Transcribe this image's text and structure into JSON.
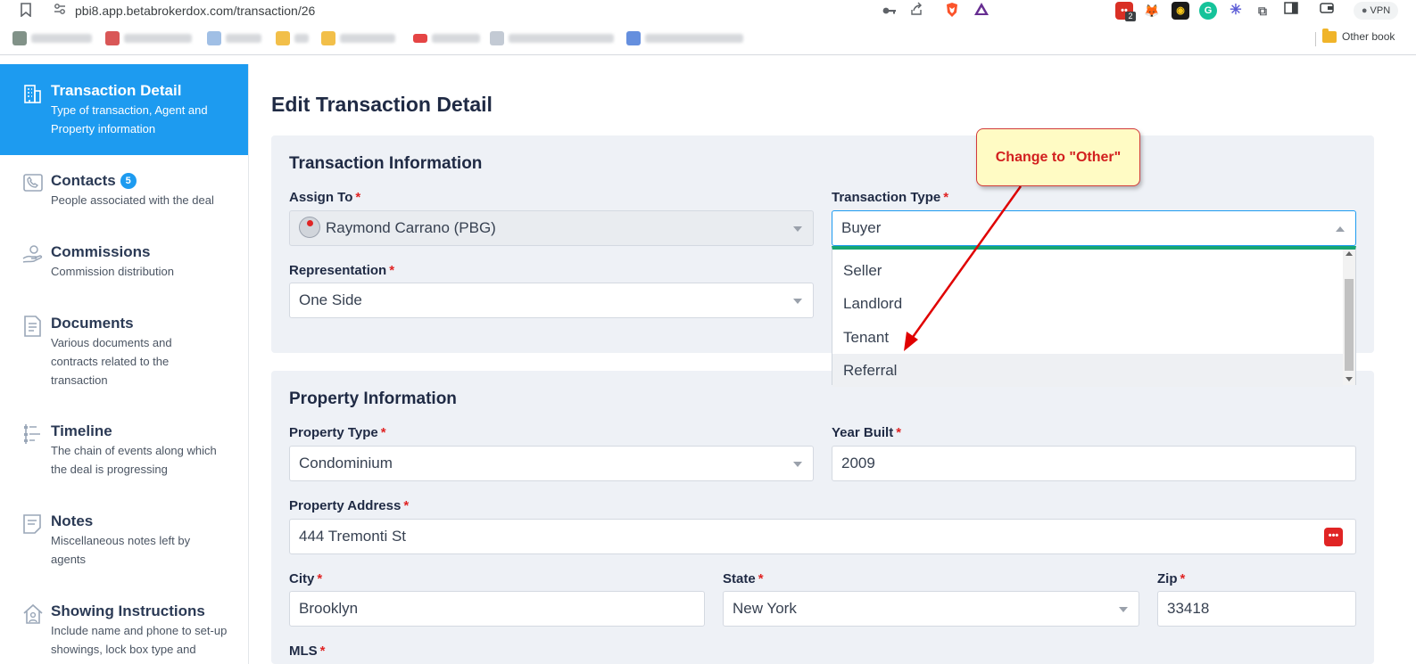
{
  "browser": {
    "url": "pbi8.app.betabrokerdox.com/transaction/26",
    "other_bookmarks": "Other book",
    "vpn_label": "VPN",
    "extension_badge": "2",
    "bookmarks": [
      {
        "color": "#6b7f73"
      },
      {
        "color": "#d23a3a"
      },
      {
        "color": "#8fb4e0"
      },
      {
        "color": "#f0b429"
      },
      {
        "color": "#f0b429"
      },
      {
        "color": "#e02424"
      },
      {
        "color": "#b9c1cc"
      },
      {
        "color": "#4a7bd8"
      }
    ]
  },
  "sidebar": {
    "items": [
      {
        "title": "Transaction Detail",
        "desc": "Type of transaction, Agent and Property information",
        "icon": "building-icon",
        "active": true
      },
      {
        "title": "Contacts",
        "desc": "People associated with the deal",
        "icon": "contacts-icon",
        "badge": "5"
      },
      {
        "title": "Commissions",
        "desc": "Commission distribution",
        "icon": "hand-coin-icon"
      },
      {
        "title": "Documents",
        "desc": "Various documents and contracts related to the transaction",
        "icon": "document-icon"
      },
      {
        "title": "Timeline",
        "desc": "The chain of events along which the deal is progressing",
        "icon": "timeline-icon"
      },
      {
        "title": "Notes",
        "desc": "Miscellaneous notes left by agents",
        "icon": "notes-icon"
      },
      {
        "title": "Showing Instructions",
        "desc": "Include name and phone to set-up showings, lock box type and",
        "icon": "house-icon"
      }
    ]
  },
  "main": {
    "page_title": "Edit Transaction Detail",
    "transaction_info": {
      "title": "Transaction Information",
      "assign_to": {
        "label": "Assign To",
        "value": "Raymond Carrano (PBG)"
      },
      "transaction_type": {
        "label": "Transaction Type",
        "value": "Buyer"
      },
      "representation": {
        "label": "Representation",
        "value": "One Side"
      }
    },
    "dropdown_options": [
      "Seller",
      "Landlord",
      "Tenant",
      "Referral"
    ],
    "property_info": {
      "title": "Property Information",
      "property_type": {
        "label": "Property Type",
        "value": "Condominium"
      },
      "year_built": {
        "label": "Year Built",
        "value": "2009"
      },
      "property_address": {
        "label": "Property Address",
        "value": "444 Tremonti St"
      },
      "city": {
        "label": "City",
        "value": "Brooklyn"
      },
      "state": {
        "label": "State",
        "value": "New York"
      },
      "zip": {
        "label": "Zip",
        "value": "33418"
      },
      "mls": {
        "label": "MLS"
      }
    },
    "required_marker": "*"
  },
  "annotation": {
    "text": "Change to \"Other\"",
    "color": "#e00000"
  },
  "colors": {
    "accent": "#1d9bf0",
    "success_bar": "#17a673",
    "required": "#e02424"
  }
}
